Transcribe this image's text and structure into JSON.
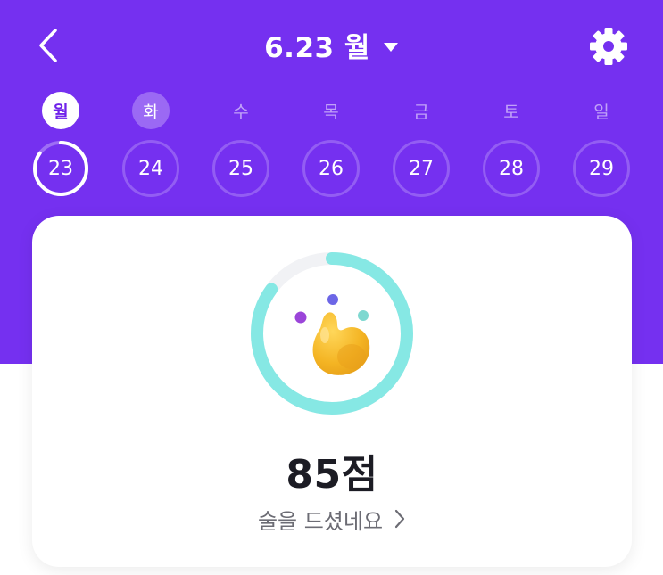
{
  "header": {
    "title": "6.23 월",
    "back_icon": "chevron-left-icon",
    "dropdown_icon": "caret-down-icon",
    "settings_icon": "gear-icon"
  },
  "week": {
    "weekdays": [
      "월",
      "화",
      "수",
      "목",
      "금",
      "토",
      "일"
    ],
    "dates": [
      "23",
      "24",
      "25",
      "26",
      "27",
      "28",
      "29"
    ],
    "selected_index": 0,
    "today_index": 1,
    "selected_progress": 0.85
  },
  "score_card": {
    "score": "85점",
    "score_value": 85,
    "message": "술을 드셨네요",
    "chevron_icon": "chevron-right-icon"
  },
  "colors": {
    "brand_purple": "#7530f0",
    "ring_cyan": "#86e8e4",
    "ring_track": "#f1f2f5",
    "mascot_yellow": "#f3b321"
  }
}
